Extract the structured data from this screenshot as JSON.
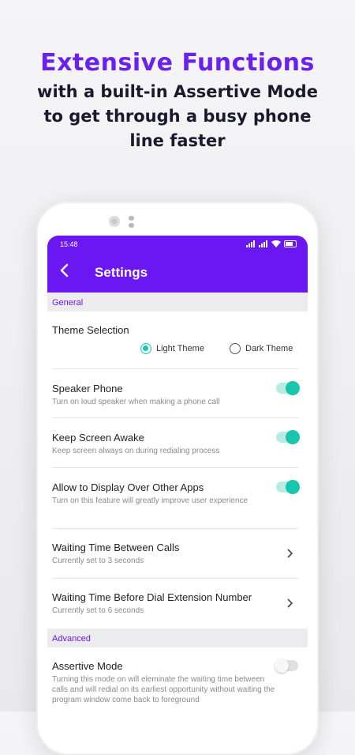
{
  "promo": {
    "title": "Extensive Functions",
    "subtitle": "with a built-in Assertive Mode to get through a busy phone line faster"
  },
  "status_bar": {
    "time": "15:48"
  },
  "app_bar": {
    "title": "Settings",
    "back_icon": "arrow-left-icon"
  },
  "colors": {
    "accent": "#6a17f2",
    "toggle_on": "#17c6ad",
    "promo_title": "#6a21f0"
  },
  "sections": {
    "general": {
      "header": "General",
      "theme": {
        "title": "Theme Selection",
        "options": [
          "Light Theme",
          "Dark Theme"
        ],
        "selected": "Light Theme"
      },
      "speaker": {
        "title": "Speaker Phone",
        "subtitle": "Turn on loud speaker when making a phone call",
        "enabled": true
      },
      "awake": {
        "title": "Keep Screen Awake",
        "subtitle": "Keep screen always on during redialing process",
        "enabled": true
      },
      "overlay": {
        "title": "Allow to Display Over Other Apps",
        "subtitle": "Turn on this feature will greatly improve user experience",
        "enabled": true
      },
      "wait_calls": {
        "title": "Waiting Time Between Calls",
        "subtitle": "Currently set to 3 seconds"
      },
      "wait_ext": {
        "title": "Waiting Time Before Dial Extension Number",
        "subtitle": "Currently set to 6 seconds"
      }
    },
    "advanced": {
      "header": "Advanced",
      "assertive": {
        "title": "Assertive Mode",
        "subtitle": "Turning this mode on will eleminate the waiting time between calls and will redial on its earliest opportunity without waiting the program window come back to foreground",
        "enabled": false
      }
    }
  }
}
